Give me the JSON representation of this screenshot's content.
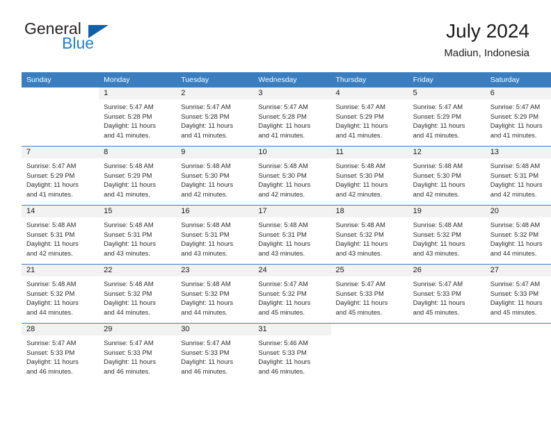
{
  "logo": {
    "word_one": "General",
    "word_two": "Blue",
    "triangle_color": "#1060a8",
    "blue_color": "#1f7fd0"
  },
  "header": {
    "title": "July 2024",
    "subtitle": "Madiun, Indonesia"
  },
  "theme": {
    "header_bg": "#3a7ec0",
    "daynum_bg": "#f2f2f2",
    "grid_line": "#3a7ec0"
  },
  "weekdays": [
    "Sunday",
    "Monday",
    "Tuesday",
    "Wednesday",
    "Thursday",
    "Friday",
    "Saturday"
  ],
  "weeks": [
    [
      {
        "day": "",
        "sunrise": "",
        "sunset": "",
        "daylight1": "",
        "daylight2": ""
      },
      {
        "day": "1",
        "sunrise": "Sunrise: 5:47 AM",
        "sunset": "Sunset: 5:28 PM",
        "daylight1": "Daylight: 11 hours",
        "daylight2": "and 41 minutes."
      },
      {
        "day": "2",
        "sunrise": "Sunrise: 5:47 AM",
        "sunset": "Sunset: 5:28 PM",
        "daylight1": "Daylight: 11 hours",
        "daylight2": "and 41 minutes."
      },
      {
        "day": "3",
        "sunrise": "Sunrise: 5:47 AM",
        "sunset": "Sunset: 5:28 PM",
        "daylight1": "Daylight: 11 hours",
        "daylight2": "and 41 minutes."
      },
      {
        "day": "4",
        "sunrise": "Sunrise: 5:47 AM",
        "sunset": "Sunset: 5:29 PM",
        "daylight1": "Daylight: 11 hours",
        "daylight2": "and 41 minutes."
      },
      {
        "day": "5",
        "sunrise": "Sunrise: 5:47 AM",
        "sunset": "Sunset: 5:29 PM",
        "daylight1": "Daylight: 11 hours",
        "daylight2": "and 41 minutes."
      },
      {
        "day": "6",
        "sunrise": "Sunrise: 5:47 AM",
        "sunset": "Sunset: 5:29 PM",
        "daylight1": "Daylight: 11 hours",
        "daylight2": "and 41 minutes."
      }
    ],
    [
      {
        "day": "7",
        "sunrise": "Sunrise: 5:47 AM",
        "sunset": "Sunset: 5:29 PM",
        "daylight1": "Daylight: 11 hours",
        "daylight2": "and 41 minutes."
      },
      {
        "day": "8",
        "sunrise": "Sunrise: 5:48 AM",
        "sunset": "Sunset: 5:29 PM",
        "daylight1": "Daylight: 11 hours",
        "daylight2": "and 41 minutes."
      },
      {
        "day": "9",
        "sunrise": "Sunrise: 5:48 AM",
        "sunset": "Sunset: 5:30 PM",
        "daylight1": "Daylight: 11 hours",
        "daylight2": "and 42 minutes."
      },
      {
        "day": "10",
        "sunrise": "Sunrise: 5:48 AM",
        "sunset": "Sunset: 5:30 PM",
        "daylight1": "Daylight: 11 hours",
        "daylight2": "and 42 minutes."
      },
      {
        "day": "11",
        "sunrise": "Sunrise: 5:48 AM",
        "sunset": "Sunset: 5:30 PM",
        "daylight1": "Daylight: 11 hours",
        "daylight2": "and 42 minutes."
      },
      {
        "day": "12",
        "sunrise": "Sunrise: 5:48 AM",
        "sunset": "Sunset: 5:30 PM",
        "daylight1": "Daylight: 11 hours",
        "daylight2": "and 42 minutes."
      },
      {
        "day": "13",
        "sunrise": "Sunrise: 5:48 AM",
        "sunset": "Sunset: 5:31 PM",
        "daylight1": "Daylight: 11 hours",
        "daylight2": "and 42 minutes."
      }
    ],
    [
      {
        "day": "14",
        "sunrise": "Sunrise: 5:48 AM",
        "sunset": "Sunset: 5:31 PM",
        "daylight1": "Daylight: 11 hours",
        "daylight2": "and 42 minutes."
      },
      {
        "day": "15",
        "sunrise": "Sunrise: 5:48 AM",
        "sunset": "Sunset: 5:31 PM",
        "daylight1": "Daylight: 11 hours",
        "daylight2": "and 43 minutes."
      },
      {
        "day": "16",
        "sunrise": "Sunrise: 5:48 AM",
        "sunset": "Sunset: 5:31 PM",
        "daylight1": "Daylight: 11 hours",
        "daylight2": "and 43 minutes."
      },
      {
        "day": "17",
        "sunrise": "Sunrise: 5:48 AM",
        "sunset": "Sunset: 5:31 PM",
        "daylight1": "Daylight: 11 hours",
        "daylight2": "and 43 minutes."
      },
      {
        "day": "18",
        "sunrise": "Sunrise: 5:48 AM",
        "sunset": "Sunset: 5:32 PM",
        "daylight1": "Daylight: 11 hours",
        "daylight2": "and 43 minutes."
      },
      {
        "day": "19",
        "sunrise": "Sunrise: 5:48 AM",
        "sunset": "Sunset: 5:32 PM",
        "daylight1": "Daylight: 11 hours",
        "daylight2": "and 43 minutes."
      },
      {
        "day": "20",
        "sunrise": "Sunrise: 5:48 AM",
        "sunset": "Sunset: 5:32 PM",
        "daylight1": "Daylight: 11 hours",
        "daylight2": "and 44 minutes."
      }
    ],
    [
      {
        "day": "21",
        "sunrise": "Sunrise: 5:48 AM",
        "sunset": "Sunset: 5:32 PM",
        "daylight1": "Daylight: 11 hours",
        "daylight2": "and 44 minutes."
      },
      {
        "day": "22",
        "sunrise": "Sunrise: 5:48 AM",
        "sunset": "Sunset: 5:32 PM",
        "daylight1": "Daylight: 11 hours",
        "daylight2": "and 44 minutes."
      },
      {
        "day": "23",
        "sunrise": "Sunrise: 5:48 AM",
        "sunset": "Sunset: 5:32 PM",
        "daylight1": "Daylight: 11 hours",
        "daylight2": "and 44 minutes."
      },
      {
        "day": "24",
        "sunrise": "Sunrise: 5:47 AM",
        "sunset": "Sunset: 5:32 PM",
        "daylight1": "Daylight: 11 hours",
        "daylight2": "and 45 minutes."
      },
      {
        "day": "25",
        "sunrise": "Sunrise: 5:47 AM",
        "sunset": "Sunset: 5:33 PM",
        "daylight1": "Daylight: 11 hours",
        "daylight2": "and 45 minutes."
      },
      {
        "day": "26",
        "sunrise": "Sunrise: 5:47 AM",
        "sunset": "Sunset: 5:33 PM",
        "daylight1": "Daylight: 11 hours",
        "daylight2": "and 45 minutes."
      },
      {
        "day": "27",
        "sunrise": "Sunrise: 5:47 AM",
        "sunset": "Sunset: 5:33 PM",
        "daylight1": "Daylight: 11 hours",
        "daylight2": "and 45 minutes."
      }
    ],
    [
      {
        "day": "28",
        "sunrise": "Sunrise: 5:47 AM",
        "sunset": "Sunset: 5:33 PM",
        "daylight1": "Daylight: 11 hours",
        "daylight2": "and 46 minutes."
      },
      {
        "day": "29",
        "sunrise": "Sunrise: 5:47 AM",
        "sunset": "Sunset: 5:33 PM",
        "daylight1": "Daylight: 11 hours",
        "daylight2": "and 46 minutes."
      },
      {
        "day": "30",
        "sunrise": "Sunrise: 5:47 AM",
        "sunset": "Sunset: 5:33 PM",
        "daylight1": "Daylight: 11 hours",
        "daylight2": "and 46 minutes."
      },
      {
        "day": "31",
        "sunrise": "Sunrise: 5:46 AM",
        "sunset": "Sunset: 5:33 PM",
        "daylight1": "Daylight: 11 hours",
        "daylight2": "and 46 minutes."
      },
      {
        "day": "",
        "sunrise": "",
        "sunset": "",
        "daylight1": "",
        "daylight2": ""
      },
      {
        "day": "",
        "sunrise": "",
        "sunset": "",
        "daylight1": "",
        "daylight2": ""
      },
      {
        "day": "",
        "sunrise": "",
        "sunset": "",
        "daylight1": "",
        "daylight2": ""
      }
    ]
  ]
}
